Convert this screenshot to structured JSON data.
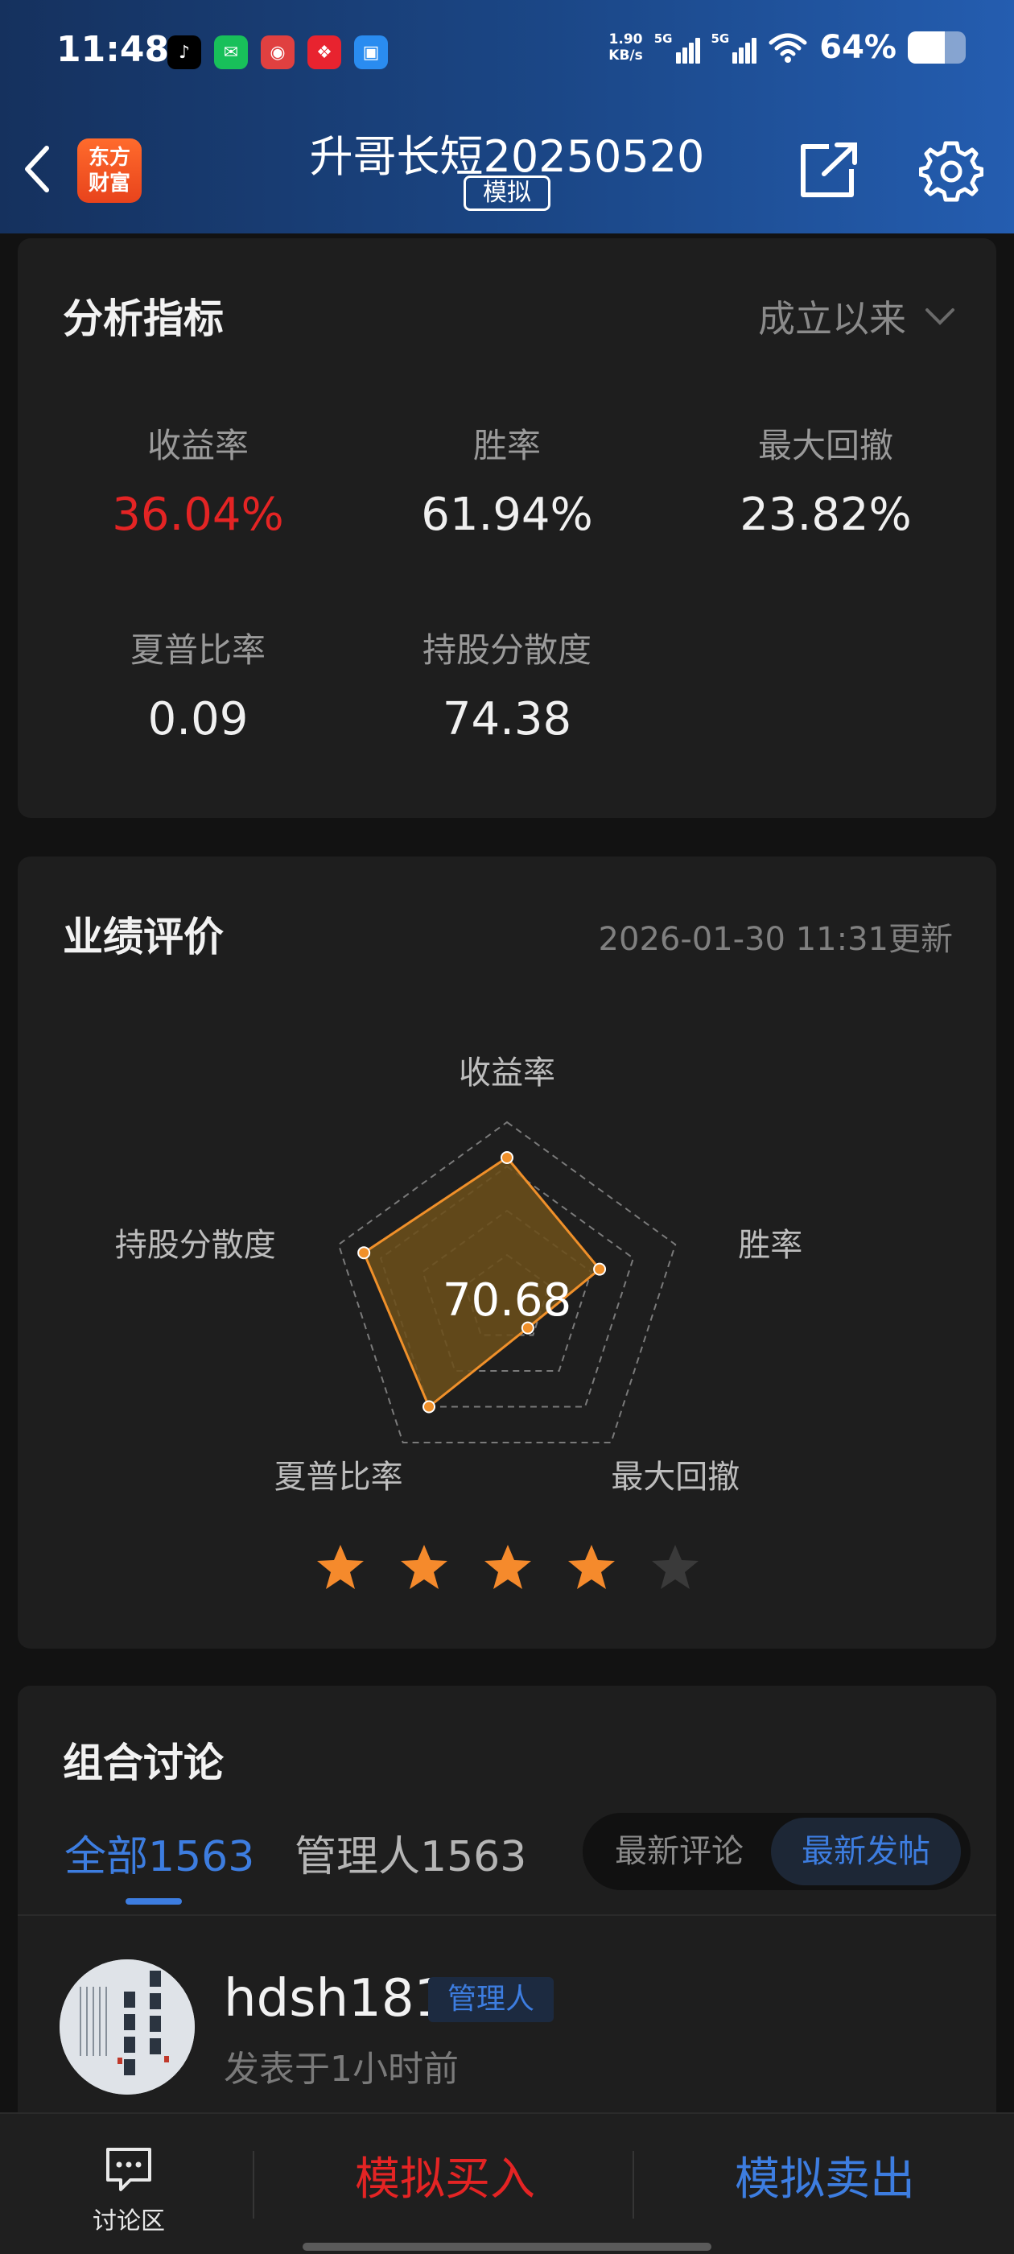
{
  "status_bar": {
    "time": "11:48",
    "net_speed_value": "1.90",
    "net_speed_unit": "KB/s",
    "signal1_label": "5G",
    "signal2_label": "5G",
    "battery": "64%",
    "battery_level": 0.64,
    "app_icons": [
      "tiktok-icon",
      "wechat-icon",
      "telecom-icon",
      "red-app-icon",
      "blue-app-icon"
    ]
  },
  "header": {
    "logo_line1": "东方",
    "logo_line2": "财富",
    "title": "升哥长短20250520",
    "mode_badge": "模拟"
  },
  "analysis": {
    "title": "分析指标",
    "period": "成立以来",
    "metrics": [
      {
        "label": "收益率",
        "value": "36.04%"
      },
      {
        "label": "胜率",
        "value": "61.94%"
      },
      {
        "label": "最大回撤",
        "value": "23.82%"
      },
      {
        "label": "夏普比率",
        "value": "0.09"
      },
      {
        "label": "持股分散度",
        "value": "74.38"
      }
    ]
  },
  "performance": {
    "title": "业绩评价",
    "updated": "2026-01-30 11:31更新",
    "score": "70.68",
    "rating": 4,
    "rating_max": 5
  },
  "chart_data": {
    "type": "radar",
    "categories": [
      "收益率",
      "胜率",
      "最大回撤",
      "夏普比率",
      "持股分散度"
    ],
    "values": [
      0.8,
      0.55,
      0.2,
      0.75,
      0.85
    ],
    "scale_max": 1,
    "grid_levels": 4,
    "fill_color": "#6b4f1a",
    "line_color": "#f0902a"
  },
  "discussion": {
    "title": "组合讨论",
    "tab_all": "全部1563",
    "tab_manager": "管理人1563",
    "seg_latest_comment": "最新评论",
    "seg_latest_post": "最新发帖",
    "post": {
      "username": "hdsh181",
      "role": "管理人",
      "time": "发表于1小时前"
    }
  },
  "bottom_bar": {
    "forum": "讨论区",
    "buy": "模拟买入",
    "sell": "模拟卖出"
  },
  "colors": {
    "header_start": "#15315e",
    "header_end": "#245db0",
    "red": "#e42424",
    "blue": "#3d7de0",
    "star_on": "#f58a2c",
    "star_off": "#3a3a3a"
  }
}
